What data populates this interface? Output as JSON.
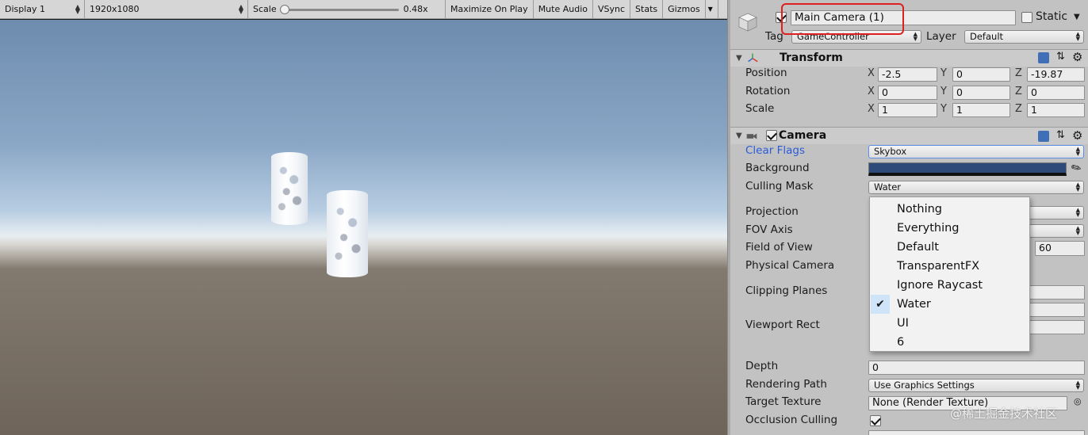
{
  "game_toolbar": {
    "display": "Display 1",
    "resolution": "1920x1080",
    "scale_label": "Scale",
    "scale_value": "0.48x",
    "maximize_on_play": "Maximize On Play",
    "mute_audio": "Mute Audio",
    "vsync": "VSync",
    "stats": "Stats",
    "gizmos": "Gizmos"
  },
  "header": {
    "object_name": "Main Camera (1)",
    "static_label": "Static",
    "tag_label": "Tag",
    "tag_value": "GameController",
    "layer_label": "Layer",
    "layer_value": "Default"
  },
  "transform": {
    "title": "Transform",
    "position": {
      "label": "Position",
      "x": "-2.5",
      "y": "0",
      "z": "-19.87"
    },
    "rotation": {
      "label": "Rotation",
      "x": "0",
      "y": "0",
      "z": "0"
    },
    "scale": {
      "label": "Scale",
      "x": "1",
      "y": "1",
      "z": "1"
    },
    "axis_x": "X",
    "axis_y": "Y",
    "axis_z": "Z"
  },
  "camera": {
    "title": "Camera",
    "clear_flags_label": "Clear Flags",
    "clear_flags_value": "Skybox",
    "background_label": "Background",
    "background_color": "#2e4a78",
    "culling_mask_label": "Culling Mask",
    "culling_mask_value": "Water",
    "projection_label": "Projection",
    "fov_axis_label": "FOV Axis",
    "field_of_view_label": "Field of View",
    "field_of_view_value": "60",
    "physical_camera_label": "Physical Camera",
    "clipping_planes_label": "Clipping Planes",
    "viewport_rect_label": "Viewport Rect",
    "depth_label": "Depth",
    "depth_value": "0",
    "rendering_path_label": "Rendering Path",
    "rendering_path_value": "Use Graphics Settings",
    "target_texture_label": "Target Texture",
    "target_texture_value": "None (Render Texture)",
    "occlusion_culling_label": "Occlusion Culling"
  },
  "culling_mask_menu": {
    "items": [
      "Nothing",
      "Everything",
      "Default",
      "TransparentFX",
      "Ignore Raycast",
      "Water",
      "UI",
      "6"
    ],
    "checked": "Water"
  },
  "watermark": "@稀土掘金技术社区",
  "colors": {
    "highlight_border": "#e02020",
    "link_label": "#2a5bd8"
  }
}
